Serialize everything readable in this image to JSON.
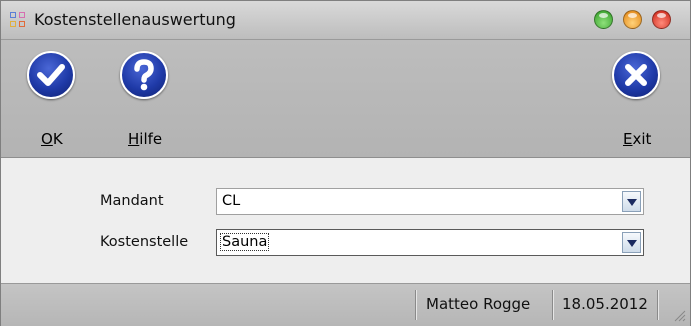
{
  "window": {
    "title": "Kostenstellenauswertung"
  },
  "toolbar": {
    "ok_mnemonic": "O",
    "ok_rest": "K",
    "help_mnemonic": "H",
    "help_rest": "ilfe",
    "exit_mnemonic": "E",
    "exit_rest": "xit"
  },
  "form": {
    "mandant": {
      "label": "Mandant",
      "value": "CL"
    },
    "kostenstelle": {
      "label": "Kostenstelle",
      "value": "Sauna"
    }
  },
  "status": {
    "user": "Matteo Rogge",
    "date": "18.05.2012"
  },
  "colors": {
    "button_blue": "#1f3aa8",
    "title_bar": "#cfcfcf",
    "toolbar": "#b8b8b8"
  }
}
